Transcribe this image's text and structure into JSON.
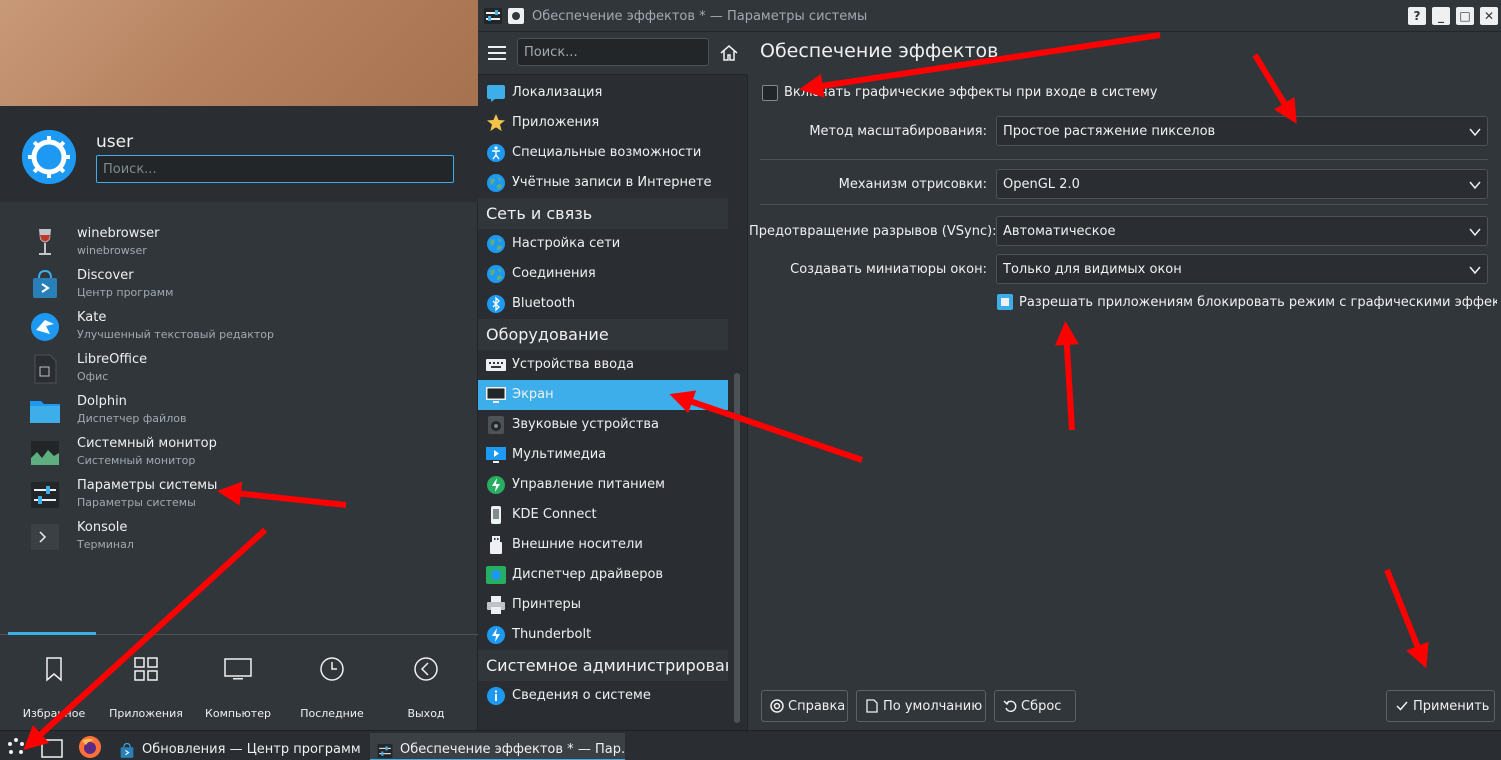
{
  "launcher": {
    "username": "user",
    "search_placeholder": "Поиск...",
    "apps": [
      {
        "name": "winebrowser",
        "desc": "winebrowser",
        "icon": "wine-glass-icon"
      },
      {
        "name": "Discover",
        "desc": "Центр программ",
        "icon": "discover-bag-icon"
      },
      {
        "name": "Kate",
        "desc": "Улучшенный текстовый редактор",
        "icon": "kate-bird-icon"
      },
      {
        "name": "LibreOffice",
        "desc": "Офис",
        "icon": "libreoffice-document-icon"
      },
      {
        "name": "Dolphin",
        "desc": "Диспетчер файлов",
        "icon": "folder-icon"
      },
      {
        "name": "Системный монитор",
        "desc": "Системный монитор",
        "icon": "system-monitor-icon"
      },
      {
        "name": "Параметры системы",
        "desc": "Параметры системы",
        "icon": "system-settings-icon"
      },
      {
        "name": "Konsole",
        "desc": "Терминал",
        "icon": "terminal-icon"
      }
    ],
    "tabs": [
      {
        "label": "Избранное",
        "icon": "bookmark-icon"
      },
      {
        "label": "Приложения",
        "icon": "app-grid-icon"
      },
      {
        "label": "Компьютер",
        "icon": "monitor-icon"
      },
      {
        "label": "Последние",
        "icon": "clock-icon"
      },
      {
        "label": "Выход",
        "icon": "leave-icon"
      }
    ]
  },
  "taskbar": {
    "tasks": [
      {
        "label": "Обновления — Центр программ ...",
        "icon": "discover-bag-icon",
        "active": false
      },
      {
        "label": "Обеспечение эффектов * — Пар...",
        "icon": "system-settings-icon",
        "active": true
      }
    ]
  },
  "window": {
    "title": "Обеспечение эффектов * — Параметры системы",
    "buttons": [
      "?",
      "_",
      "□",
      "✕"
    ],
    "sidebar": {
      "search_placeholder": "Поиск...",
      "items": [
        {
          "type": "item",
          "label": "Локализация",
          "icon": "localization-flag-icon"
        },
        {
          "type": "item",
          "label": "Приложения",
          "icon": "star-icon"
        },
        {
          "type": "item",
          "label": "Специальные возможности",
          "icon": "accessibility-icon"
        },
        {
          "type": "item",
          "label": "Учётные записи в Интернете",
          "icon": "globe-icon"
        },
        {
          "type": "category",
          "label": "Сеть и связь"
        },
        {
          "type": "item",
          "label": "Настройка сети",
          "icon": "globe-icon"
        },
        {
          "type": "item",
          "label": "Соединения",
          "icon": "globe-icon"
        },
        {
          "type": "item",
          "label": "Bluetooth",
          "icon": "bluetooth-icon"
        },
        {
          "type": "category",
          "label": "Оборудование"
        },
        {
          "type": "item",
          "label": "Устройства ввода",
          "icon": "keyboard-icon"
        },
        {
          "type": "item",
          "label": "Экран",
          "icon": "display-icon",
          "selected": true
        },
        {
          "type": "item",
          "label": "Звуковые устройства",
          "icon": "speaker-icon"
        },
        {
          "type": "item",
          "label": "Мультимедиа",
          "icon": "multimedia-icon"
        },
        {
          "type": "item",
          "label": "Управление питанием",
          "icon": "power-icon"
        },
        {
          "type": "item",
          "label": "KDE Connect",
          "icon": "kde-connect-icon"
        },
        {
          "type": "item",
          "label": "Внешние носители",
          "icon": "usb-icon"
        },
        {
          "type": "item",
          "label": "Диспетчер драйверов",
          "icon": "driver-chip-icon"
        },
        {
          "type": "item",
          "label": "Принтеры",
          "icon": "printer-icon"
        },
        {
          "type": "item",
          "label": "Thunderbolt",
          "icon": "thunderbolt-icon"
        },
        {
          "type": "category",
          "label": "Системное администрирование"
        },
        {
          "type": "item",
          "label": "Сведения о системе",
          "icon": "info-icon"
        }
      ]
    },
    "content": {
      "title": "Обеспечение эффектов",
      "enable_effects": {
        "label": "Включать графические эффекты при входе в систему",
        "checked": false
      },
      "scale_method": {
        "label": "Метод масштабирования:",
        "value": "Простое растяжение пикселов"
      },
      "renderer": {
        "label": "Механизм отрисовки:",
        "value": "OpenGL 2.0"
      },
      "vsync": {
        "label": "Предотвращение разрывов (VSync):",
        "value": "Автоматическое"
      },
      "thumbnails": {
        "label": "Создавать миниатюры окон:",
        "value": "Только для видимых окон"
      },
      "allow_block": {
        "label": "Разрешать приложениям блокировать режим с графическими эффектами",
        "checked": true
      },
      "buttons": {
        "help": "Справка",
        "defaults": "По умолчанию",
        "reset": "Сброс",
        "apply": "Применить"
      }
    }
  },
  "colors": {
    "accent": "#3daee9",
    "arrow": "#ff0000",
    "bg": "#31363b"
  }
}
